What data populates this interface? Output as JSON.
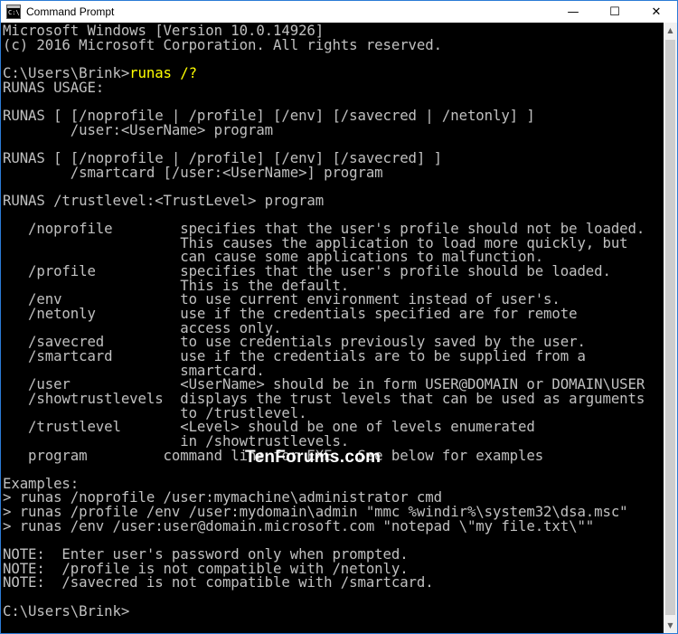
{
  "window": {
    "title": "Command Prompt",
    "icon_text": "C:\\",
    "controls": {
      "minimize": "—",
      "maximize": "☐",
      "close": "✕"
    }
  },
  "console": {
    "lines": [
      {
        "a": "Microsoft Windows [Version 10.0.14926]",
        "b": ""
      },
      {
        "a": "(c) 2016 Microsoft Corporation. All rights reserved.",
        "b": ""
      },
      {
        "a": "",
        "b": ""
      },
      {
        "a": "C:\\Users\\Brink>",
        "b": "runas /?"
      },
      {
        "a": "RUNAS USAGE:",
        "b": ""
      },
      {
        "a": "",
        "b": ""
      },
      {
        "a": "RUNAS [ [/noprofile | /profile] [/env] [/savecred | /netonly] ]",
        "b": ""
      },
      {
        "a": "        /user:<UserName> program",
        "b": ""
      },
      {
        "a": "",
        "b": ""
      },
      {
        "a": "RUNAS [ [/noprofile | /profile] [/env] [/savecred] ]",
        "b": ""
      },
      {
        "a": "        /smartcard [/user:<UserName>] program",
        "b": ""
      },
      {
        "a": "",
        "b": ""
      },
      {
        "a": "RUNAS /trustlevel:<TrustLevel> program",
        "b": ""
      },
      {
        "a": "",
        "b": ""
      },
      {
        "a": "   /noprofile        specifies that the user's profile should not be loaded.",
        "b": ""
      },
      {
        "a": "                     This causes the application to load more quickly, but",
        "b": ""
      },
      {
        "a": "                     can cause some applications to malfunction.",
        "b": ""
      },
      {
        "a": "   /profile          specifies that the user's profile should be loaded.",
        "b": ""
      },
      {
        "a": "                     This is the default.",
        "b": ""
      },
      {
        "a": "   /env              to use current environment instead of user's.",
        "b": ""
      },
      {
        "a": "   /netonly          use if the credentials specified are for remote",
        "b": ""
      },
      {
        "a": "                     access only.",
        "b": ""
      },
      {
        "a": "   /savecred         to use credentials previously saved by the user.",
        "b": ""
      },
      {
        "a": "   /smartcard        use if the credentials are to be supplied from a",
        "b": ""
      },
      {
        "a": "                     smartcard.",
        "b": ""
      },
      {
        "a": "   /user             <UserName> should be in form USER@DOMAIN or DOMAIN\\USER",
        "b": ""
      },
      {
        "a": "   /showtrustlevels  displays the trust levels that can be used as arguments",
        "b": ""
      },
      {
        "a": "                     to /trustlevel.",
        "b": ""
      },
      {
        "a": "   /trustlevel       <Level> should be one of levels enumerated",
        "b": ""
      },
      {
        "a": "                     in /showtrustlevels.",
        "b": ""
      },
      {
        "a": "   program         command line for EXE.  See below for examples",
        "b": ""
      },
      {
        "a": "",
        "b": ""
      },
      {
        "a": "Examples:",
        "b": ""
      },
      {
        "a": "> runas /noprofile /user:mymachine\\administrator cmd",
        "b": ""
      },
      {
        "a": "> runas /profile /env /user:mydomain\\admin \"mmc %windir%\\system32\\dsa.msc\"",
        "b": ""
      },
      {
        "a": "> runas /env /user:user@domain.microsoft.com \"notepad \\\"my file.txt\\\"\"",
        "b": ""
      },
      {
        "a": "",
        "b": ""
      },
      {
        "a": "NOTE:  Enter user's password only when prompted.",
        "b": ""
      },
      {
        "a": "NOTE:  /profile is not compatible with /netonly.",
        "b": ""
      },
      {
        "a": "NOTE:  /savecred is not compatible with /smartcard.",
        "b": ""
      },
      {
        "a": "",
        "b": ""
      },
      {
        "a": "C:\\Users\\Brink>",
        "b": ""
      }
    ]
  },
  "watermark": "TenForums.com",
  "colors": {
    "console_bg": "#000000",
    "console_text": "#c0c0c0",
    "typed_command": "#ffff00",
    "window_border": "#2b7bd6"
  },
  "scrollbar": {
    "up": "▲",
    "down": "▼"
  }
}
